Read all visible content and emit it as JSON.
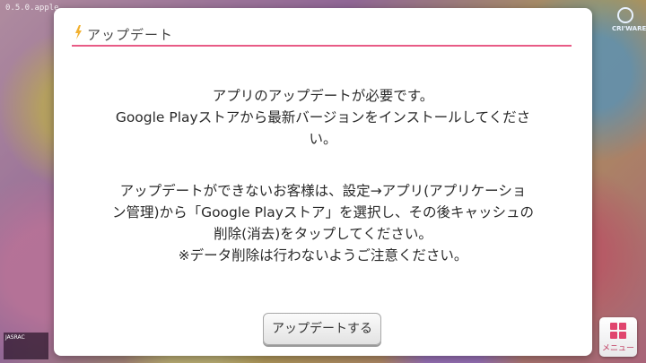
{
  "background": {
    "version": "0.5.0.apple",
    "left_strip_label": "JASRAC"
  },
  "brand": {
    "text": "CRI'WARE"
  },
  "dialog": {
    "title": "アップデート",
    "accent_color": "#e85b86",
    "paragraph1": [
      "アプリのアップデートが必要です。",
      "Google Playストアから最新バージョンをインストールしてくださ",
      "い。"
    ],
    "paragraph2": [
      "アップデートができないお客様は、設定→アプリ(アプリケーショ",
      "ン管理)から「Google Playストア」を選択し、その後キャッシュの",
      "削除(消去)をタップしてください。",
      "※データ削除は行わないようご注意ください。"
    ],
    "update_button_label": "アップデートする"
  },
  "menu": {
    "label": "メニュー",
    "icon": "grid-icon"
  }
}
